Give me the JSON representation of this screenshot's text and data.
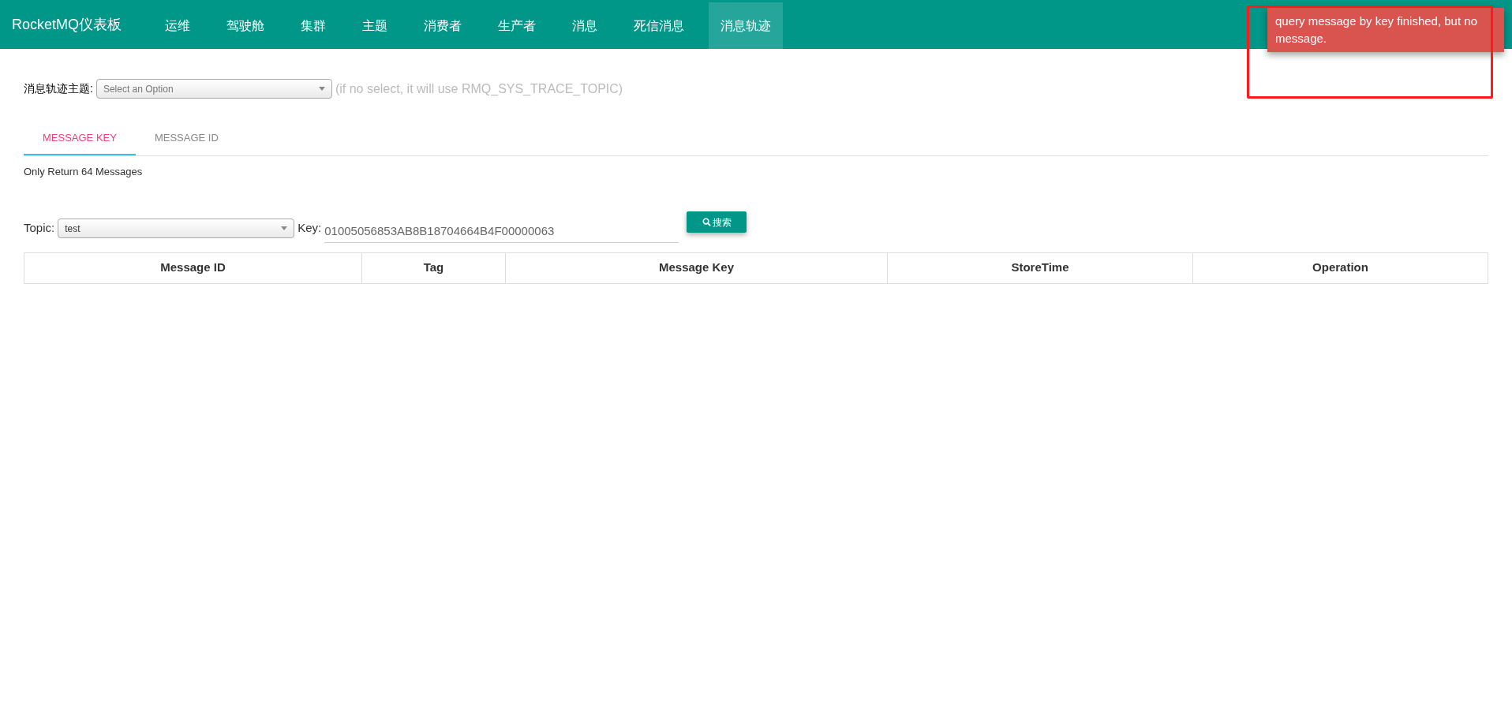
{
  "navbar": {
    "brand": "RocketMQ仪表板",
    "items": [
      {
        "label": "运维",
        "selected": false
      },
      {
        "label": "驾驶舱",
        "selected": false
      },
      {
        "label": "集群",
        "selected": false
      },
      {
        "label": "主题",
        "selected": false
      },
      {
        "label": "消费者",
        "selected": false
      },
      {
        "label": "生产者",
        "selected": false
      },
      {
        "label": "消息",
        "selected": false
      },
      {
        "label": "死信消息",
        "selected": false
      },
      {
        "label": "消息轨迹",
        "selected": true
      }
    ]
  },
  "toast": {
    "message": "query message by key finished, but no message."
  },
  "trace_topic": {
    "label": "消息轨迹主题:",
    "placeholder": "Select an Option",
    "hint": "(if no select, it will use RMQ_SYS_TRACE_TOPIC)"
  },
  "tabs": [
    {
      "label": "MESSAGE KEY",
      "selected": true
    },
    {
      "label": "MESSAGE ID",
      "selected": false
    }
  ],
  "note": "Only Return 64 Messages",
  "query": {
    "topic_label": "Topic:",
    "topic_value": "test",
    "key_label": "Key:",
    "key_value": "01005056853AB8B18704664B4F00000063",
    "search_button": "搜索"
  },
  "table": {
    "columns": [
      "Message ID",
      "Tag",
      "Message Key",
      "StoreTime",
      "Operation"
    ]
  }
}
